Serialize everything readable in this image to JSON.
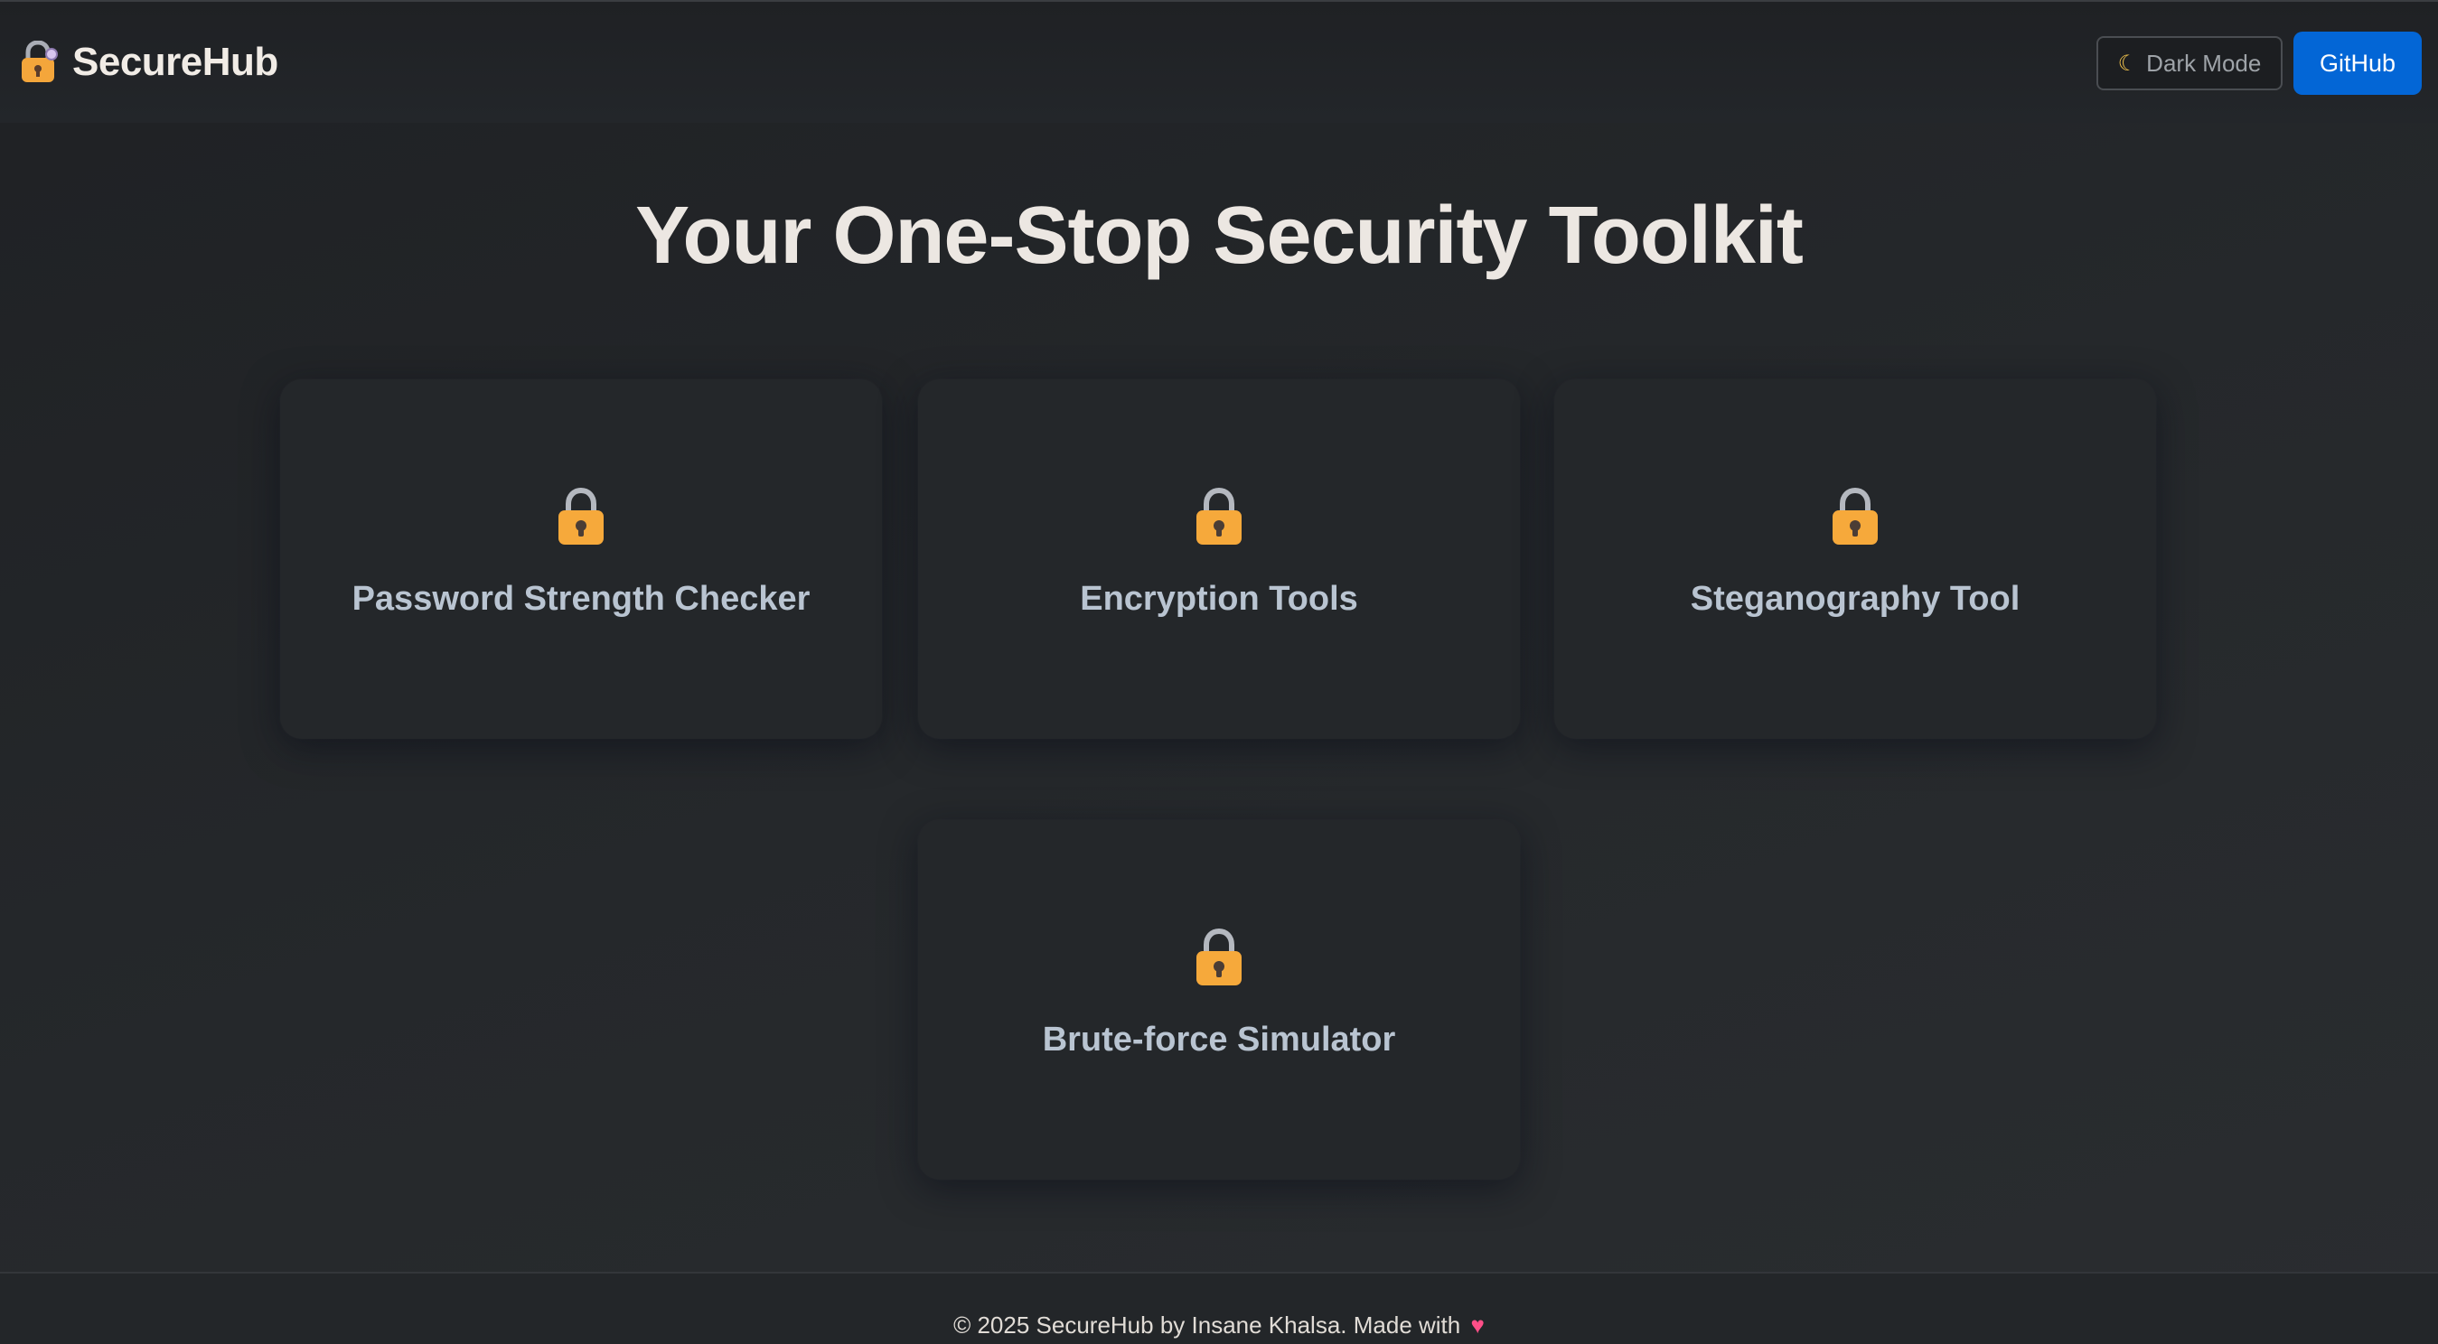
{
  "header": {
    "brand_name": "SecureHub",
    "brand_icon": "lock-key-icon",
    "dark_mode_icon": "moon-icon",
    "dark_mode_label": "Dark Mode",
    "github_label": "GitHub"
  },
  "hero": {
    "title": "Your One-Stop Security Toolkit"
  },
  "tools": [
    {
      "icon": "lock-icon",
      "label": "Password Strength Checker"
    },
    {
      "icon": "lock-icon",
      "label": "Encryption Tools"
    },
    {
      "icon": "lock-icon",
      "label": "Steganography Tool"
    },
    {
      "icon": "lock-icon",
      "label": "Brute-force Simulator"
    }
  ],
  "footer": {
    "text": "© 2025 SecureHub by Insane Khalsa. Made with",
    "heart_icon": "heart-icon"
  },
  "colors": {
    "accent": "#0366d6",
    "background": "#25282b",
    "card": "#24272a",
    "card_title": "#b9c4d1",
    "lock_gold": "#f6a93b"
  }
}
